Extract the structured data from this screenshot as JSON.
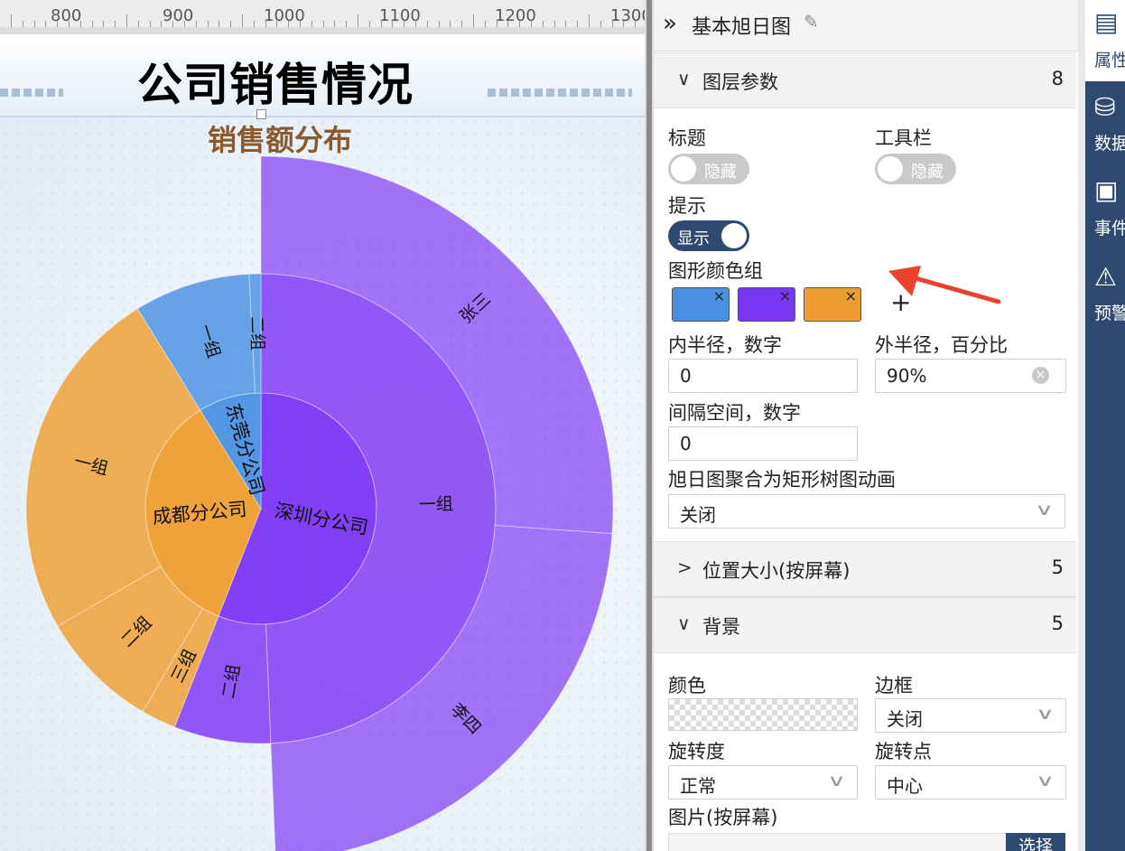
{
  "canvas": {
    "ruler": {
      "labels": [
        "800",
        "900",
        "1000",
        "1100",
        "1200",
        "1300"
      ]
    },
    "title": "公司销售情况",
    "subtitle": "销售额分布"
  },
  "chart_data": {
    "type": "sunburst",
    "title": "销售额分布",
    "colors": [
      "#4a90e2",
      "#7b35f5",
      "#ee9d2f"
    ],
    "series": [
      {
        "name": "东莞分公司",
        "color": "#4a90e2",
        "children": [
          {
            "name": "一组",
            "value": 3
          },
          {
            "name": "二组",
            "value": 0.3
          }
        ]
      },
      {
        "name": "深圳分公司",
        "color": "#7b35f5",
        "children": [
          {
            "name": "一组",
            "value": 18.5,
            "children": [
              {
                "name": "张三",
                "value": 9.8
              },
              {
                "name": "李四",
                "value": 8.7
              }
            ]
          },
          {
            "name": "二组",
            "value": 2.5
          }
        ]
      },
      {
        "name": "成都分公司",
        "color": "#ee9d2f",
        "children": [
          {
            "name": "三组",
            "value": 0.9
          },
          {
            "name": "二组",
            "value": 3.1
          },
          {
            "name": "一组",
            "value": 9.2
          }
        ]
      }
    ],
    "inner_radius": "0",
    "outer_radius": "90%"
  },
  "panel": {
    "header_title": "基本旭日图",
    "sections": {
      "layer": {
        "name": "图层参数",
        "count": "8"
      },
      "position": {
        "name": "位置大小(按屏幕)",
        "count": "5"
      },
      "background": {
        "name": "背景",
        "count": "5"
      }
    },
    "layer": {
      "title_label": "标题",
      "title_toggle": "隐藏",
      "toolbar_label": "工具栏",
      "toolbar_toggle": "隐藏",
      "tooltip_label": "提示",
      "tooltip_toggle": "显示",
      "colors_label": "图形颜色组",
      "swatches": [
        "#4a90e2",
        "#7b35f5",
        "#ee9d2f"
      ],
      "swatch_remove": "×",
      "add_color": "+",
      "inner_radius_label": "内半径，数字",
      "inner_radius_value": "0",
      "outer_radius_label": "外半径，百分比",
      "outer_radius_value": "90%",
      "gap_label": "间隔空间，数字",
      "gap_value": "0",
      "treemap_label": "旭日图聚合为矩形树图动画",
      "treemap_value": "关闭"
    },
    "background": {
      "color_label": "颜色",
      "border_label": "边框",
      "border_value": "关闭",
      "rotation_label": "旋转度",
      "rotation_value": "正常",
      "pivot_label": "旋转点",
      "pivot_value": "中心",
      "image_label": "图片(按屏幕)",
      "choose_button": "选择"
    }
  },
  "sidebar": {
    "items": [
      {
        "label": "属性",
        "icon": "properties-icon"
      },
      {
        "label": "数据",
        "icon": "database-icon"
      },
      {
        "label": "事件",
        "icon": "event-icon"
      },
      {
        "label": "预警",
        "icon": "alarm-icon"
      }
    ]
  },
  "annotation": {
    "arrow_color": "#e8412c"
  }
}
